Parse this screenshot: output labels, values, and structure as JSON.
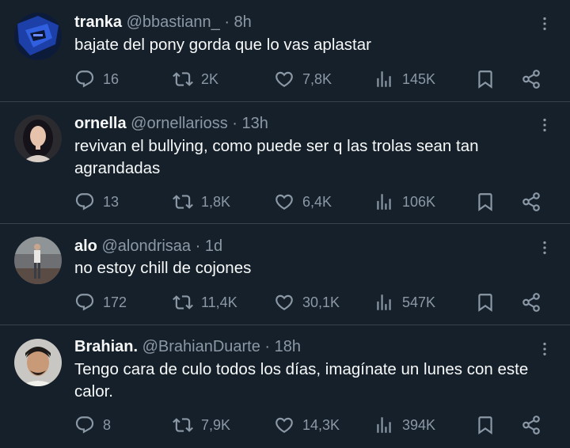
{
  "tweets": [
    {
      "name": "tranka",
      "handle": "@bbastiann_",
      "separator": " · ",
      "time": "8h",
      "text": "bajate del pony gorda que lo vas aplastar",
      "replies": "16",
      "retweets": "2K",
      "likes": "7,8K",
      "views": "145K"
    },
    {
      "name": "ornella",
      "handle": "@ornellarioss",
      "separator": " · ",
      "time": "13h",
      "text": "revivan el bullying, como puede ser q las trolas sean tan agrandadas",
      "replies": "13",
      "retweets": "1,8K",
      "likes": "6,4K",
      "views": "106K"
    },
    {
      "name": "alo",
      "handle": "@alondrisaa",
      "separator": " · ",
      "time": "1d",
      "text": "no estoy chill de cojones",
      "replies": "172",
      "retweets": "11,4K",
      "likes": "30,1K",
      "views": "547K"
    },
    {
      "name": "Brahian.",
      "handle": "@BrahianDuarte",
      "separator": " · ",
      "time": "18h",
      "text": "Tengo cara de culo todos los días, imagínate un lunes con este calor.",
      "replies": "8",
      "retweets": "7,9K",
      "likes": "14,3K",
      "views": "394K"
    }
  ],
  "colors": {
    "background": "#15202b",
    "text_primary": "#f7f9f9",
    "text_secondary": "#8b98a5",
    "divider": "#38444d"
  }
}
